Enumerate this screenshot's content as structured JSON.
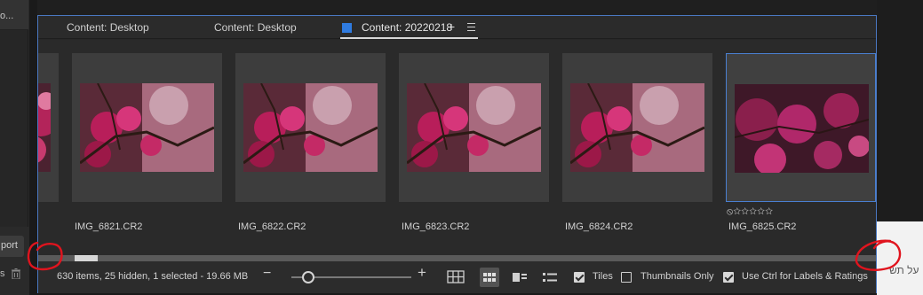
{
  "left_panel": {
    "stub_text": "o...",
    "export_label": "port",
    "bottom_text": "s"
  },
  "tabs": [
    {
      "label": "Content: Desktop",
      "active": false
    },
    {
      "label": "Content: Desktop",
      "active": false
    },
    {
      "label": "Content: 20220218",
      "active": true
    }
  ],
  "thumbnails": [
    {
      "label": "IMG_6821.CR2",
      "selected": false
    },
    {
      "label": "IMG_6822.CR2",
      "selected": false
    },
    {
      "label": "IMG_6823.CR2",
      "selected": false
    },
    {
      "label": "IMG_6824.CR2",
      "selected": false
    },
    {
      "label": "IMG_6825.CR2",
      "selected": true
    }
  ],
  "selected_rating": {
    "reject": "⦸",
    "stars": "☆☆☆☆☆"
  },
  "status": {
    "summary": "630 items, 25 hidden, 1 selected - 19.66 MB",
    "zoom_level": 0.14
  },
  "options": {
    "tiles_label": "Tiles",
    "tiles_checked": true,
    "thumbnails_only_label": "Thumbnails Only",
    "thumbnails_only_checked": false,
    "ctrl_labels_label": "Use Ctrl for Labels & Ratings",
    "ctrl_labels_checked": true
  },
  "right_text": "על תש",
  "colors": {
    "accent": "#2f7be0",
    "selection_border": "#4a7fd1",
    "annotation": "#e0141e"
  }
}
